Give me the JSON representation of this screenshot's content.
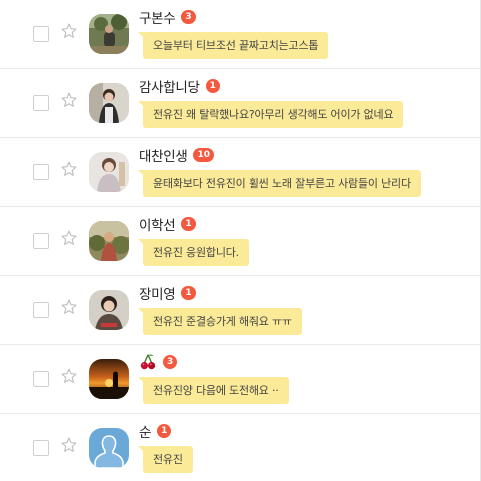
{
  "colors": {
    "badge": "#f4583e",
    "bubble": "#fbeb99",
    "divider": "#e9e9e9"
  },
  "chats": [
    {
      "name": "구본수",
      "unread": "3",
      "message": "오늘부터 티브조선 끝짜고치는고스톱",
      "avatar": "photo-avatar-outdoor"
    },
    {
      "name": "감사합니당",
      "unread": "1",
      "message": "전유진 왜 탈락했나요?아무리 생각해도 어이가 없네요",
      "avatar": "photo-avatar-person"
    },
    {
      "name": "대찬인생",
      "unread": "10",
      "message": "윤태화보다 전유진이 휠씬 노래 잘부른고 사람들이 난리다",
      "avatar": "photo-avatar-person-light"
    },
    {
      "name": "이학선",
      "unread": "1",
      "message": "전유진 응원합니다.",
      "avatar": "photo-avatar-plants"
    },
    {
      "name": "장미영",
      "unread": "1",
      "message": "전유진 준결승가게 해줘요 ㅠㅠ",
      "avatar": "photo-avatar-portrait"
    },
    {
      "name": "",
      "name_icon": "cherry-icon",
      "unread": "3",
      "message": "전유진양 다음에 도전해요 ··",
      "avatar": "photo-avatar-sunset"
    },
    {
      "name": "순",
      "unread": "1",
      "message": "전유진",
      "avatar": "default-avatar"
    }
  ]
}
